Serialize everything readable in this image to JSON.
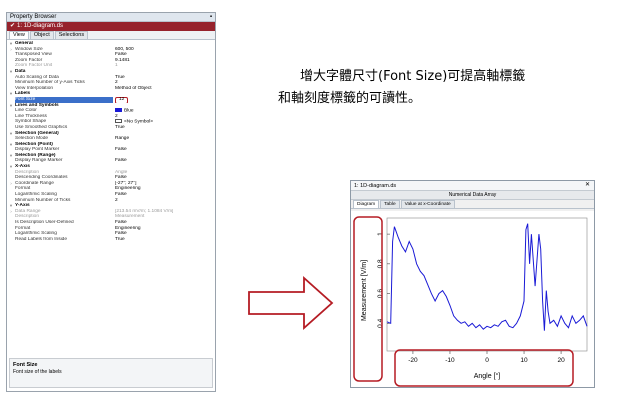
{
  "property_browser": {
    "title": "Property Browser",
    "document_label": "1: 1D-diagram.ds",
    "tabs": [
      {
        "label": "View"
      },
      {
        "label": "Object"
      },
      {
        "label": "Selections"
      }
    ],
    "rows": [
      {
        "kind": "cat",
        "name": "General",
        "value": ""
      },
      {
        "kind": "item",
        "name": "Window Size",
        "value": "600, 500",
        "expand": ">"
      },
      {
        "kind": "item",
        "name": "Transposed View",
        "value": "False"
      },
      {
        "kind": "item",
        "name": "Zoom Factor",
        "value": "9.1481"
      },
      {
        "kind": "dim",
        "name": "Zoom Factor Unit",
        "value": "1"
      },
      {
        "kind": "cat",
        "name": "Data",
        "value": ""
      },
      {
        "kind": "item",
        "name": "Auto Scaling of Data",
        "value": "True"
      },
      {
        "kind": "item",
        "name": "Minimum Number of y-Axis Ticks",
        "value": "2"
      },
      {
        "kind": "item",
        "name": "View Interpolation",
        "value": "Method of Object"
      },
      {
        "kind": "cat",
        "name": "Labels",
        "value": ""
      },
      {
        "kind": "sel",
        "name": "Font Size",
        "value": "12",
        "boxed": true
      },
      {
        "kind": "cat",
        "name": "Lines and Symbols",
        "value": ""
      },
      {
        "kind": "item",
        "name": "Line Color",
        "value": "Blue",
        "swatch": "blue"
      },
      {
        "kind": "item",
        "name": "Line Thickness",
        "value": "2"
      },
      {
        "kind": "item",
        "name": "Symbol Shape",
        "value": "<No Symbol>",
        "swatch": "none"
      },
      {
        "kind": "item",
        "name": "Use Smoothed Graphics",
        "value": "True"
      },
      {
        "kind": "cat",
        "name": "Selection (General)",
        "value": ""
      },
      {
        "kind": "item",
        "name": "Selection Mode",
        "value": "Range"
      },
      {
        "kind": "cat",
        "name": "Selection (Point)",
        "value": ""
      },
      {
        "kind": "item",
        "name": "Display Point Marker",
        "value": "False"
      },
      {
        "kind": "cat",
        "name": "Selection (Range)",
        "value": ""
      },
      {
        "kind": "item",
        "name": "Display Range Marker",
        "value": "False"
      },
      {
        "kind": "cat",
        "name": "X-Axis",
        "value": ""
      },
      {
        "kind": "dim",
        "name": "Description",
        "value": "Angle"
      },
      {
        "kind": "item",
        "name": "Descending Coordinates",
        "value": "False"
      },
      {
        "kind": "item",
        "name": "Coordinate Range",
        "value": "[-27°; 27°]",
        "expand": ">"
      },
      {
        "kind": "item",
        "name": "Format",
        "value": "Engineering"
      },
      {
        "kind": "item",
        "name": "Logarithmic Scaling",
        "value": "False"
      },
      {
        "kind": "item",
        "name": "Minimum Number of Ticks",
        "value": "2"
      },
      {
        "kind": "cat",
        "name": "Y-Axis",
        "value": ""
      },
      {
        "kind": "dim",
        "name": "Data Range",
        "value": "[213.54 mV/m; 1.1084 V/m]",
        "expand": ">"
      },
      {
        "kind": "dim",
        "name": "Description",
        "value": "Measurement"
      },
      {
        "kind": "item",
        "name": "Is Description User-Defined",
        "value": "False"
      },
      {
        "kind": "item",
        "name": "Format",
        "value": "Engineering"
      },
      {
        "kind": "item",
        "name": "Logarithmic Scaling",
        "value": "False"
      },
      {
        "kind": "item",
        "name": "Read Labels from Inside",
        "value": "True"
      }
    ],
    "description": {
      "title": "Font Size",
      "text": "Font size of the labels"
    }
  },
  "caption": {
    "line1": "增大字體尺寸(Font Size)可提高軸標籤",
    "line2": "和軸刻度標籤的可讀性。"
  },
  "diagram_window": {
    "title": "1: 1D-diagram.ds",
    "header": "Numerical Data Array",
    "tabs": [
      {
        "label": "Diagram"
      },
      {
        "label": "Table"
      },
      {
        "label": "Value at x-Coordinate"
      }
    ],
    "close_glyph": "✕"
  },
  "colors": {
    "highlight": "#b51c24",
    "line": "#1a1ad6",
    "selection": "#3b6fc9"
  },
  "chart_data": {
    "type": "line",
    "xlabel": "Angle [°]",
    "ylabel": "Measurement [V/m]",
    "xlim": [
      -27,
      27
    ],
    "ylim": [
      0.21354,
      1.1084
    ],
    "xticks": [
      -20,
      -10,
      0,
      10,
      20
    ],
    "yticks": [
      0.4,
      0.6,
      0.8,
      1
    ],
    "grid": false,
    "series": [
      {
        "x": [
          -27,
          -26,
          -25.5,
          -25,
          -24,
          -23,
          -22,
          -21,
          -20,
          -19,
          -18,
          -17,
          -16,
          -15,
          -14,
          -13,
          -12,
          -11,
          -10,
          -9,
          -8,
          -7,
          -6,
          -5,
          -4,
          -3,
          -2,
          -1,
          0,
          1,
          2,
          3,
          4,
          5,
          6,
          7,
          8,
          9,
          10,
          10.5,
          11,
          11.5,
          12,
          13,
          14,
          14.5,
          15,
          15.5,
          16,
          16.5,
          17,
          18,
          19,
          20,
          21,
          22,
          23,
          24,
          25,
          26,
          27
        ],
        "y": [
          0.41,
          0.4,
          0.95,
          1.05,
          0.98,
          0.92,
          0.88,
          0.95,
          0.9,
          0.8,
          0.75,
          0.72,
          0.66,
          0.6,
          0.55,
          0.6,
          0.62,
          0.58,
          0.52,
          0.45,
          0.42,
          0.4,
          0.41,
          0.38,
          0.4,
          0.37,
          0.39,
          0.36,
          0.38,
          0.37,
          0.39,
          0.38,
          0.41,
          0.42,
          0.38,
          0.37,
          0.4,
          0.45,
          0.55,
          1.03,
          1.07,
          0.8,
          1.0,
          0.65,
          1.0,
          0.9,
          0.55,
          0.35,
          0.62,
          0.48,
          0.4,
          0.42,
          0.38,
          0.45,
          0.4,
          0.37,
          0.45,
          0.4,
          0.42,
          0.45,
          0.38
        ]
      }
    ]
  }
}
